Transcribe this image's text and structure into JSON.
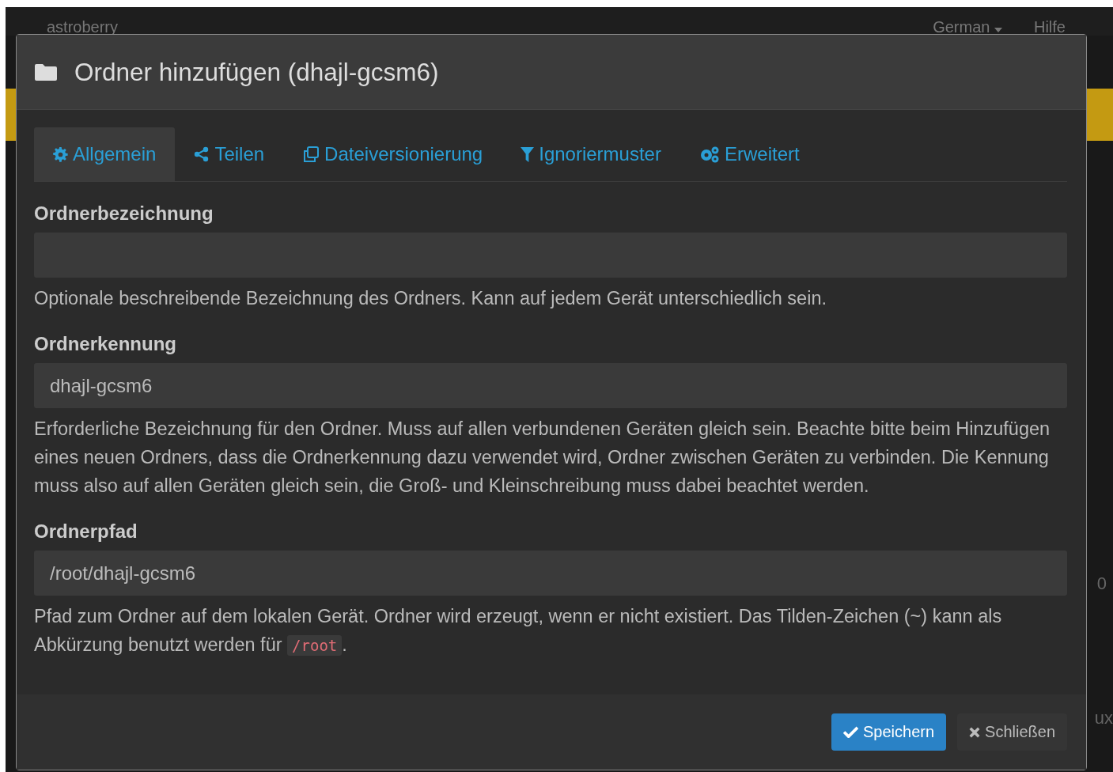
{
  "navbar": {
    "brand": "astroberry",
    "language": "German",
    "help": "Hilfe"
  },
  "background_fragments": [
    "0",
    "ux"
  ],
  "dialog": {
    "title": "Ordner hinzufügen (dhajl-gcsm6)",
    "tabs": [
      {
        "label": "Allgemein",
        "kind": "gear",
        "selected": true
      },
      {
        "label": "Teilen",
        "kind": "share",
        "selected": false
      },
      {
        "label": "Dateiversionierung",
        "kind": "copy",
        "selected": false
      },
      {
        "label": "Ignoriermuster",
        "kind": "filter",
        "selected": false
      },
      {
        "label": "Erweitert",
        "kind": "gears",
        "selected": false
      }
    ],
    "fields": [
      {
        "label": "Ordnerbezeichnung",
        "help": [
          "Optionale beschreibende Bezeichnung des Ordners. Kann auf jedem Gerät unterschiedlich sein."
        ]
      },
      {
        "label": "Ordnerkennung",
        "value": "dhajl-gcsm6",
        "help": [
          "Erforderliche Bezeichnung für den Ordner. Muss auf allen verbundenen Geräten gleich sein. Beachte bitte beim Hinzufügen eines neuen Ordners, dass die Ordnerkennung dazu verwendet wird, Ordner zwischen Geräten zu verbinden. Die Kennung muss also auf allen Geräten gleich sein, die Groß- und Kleinschreibung muss dabei beachtet werden."
        ]
      },
      {
        "label": "Ordnerpfad",
        "value": "/root/dhajl-gcsm6",
        "help": [
          "Pfad zum Ordner auf dem lokalen Gerät. Ordner wird erzeugt, wenn er nicht existiert. Das Tilden-Zeichen (~) kann als Abkürzung benutzt werden für ",
          "/root",
          "."
        ]
      }
    ],
    "buttons": [
      {
        "label": "Speichern",
        "kind": "primary"
      },
      {
        "label": "Schließen",
        "kind": "default"
      }
    ]
  }
}
